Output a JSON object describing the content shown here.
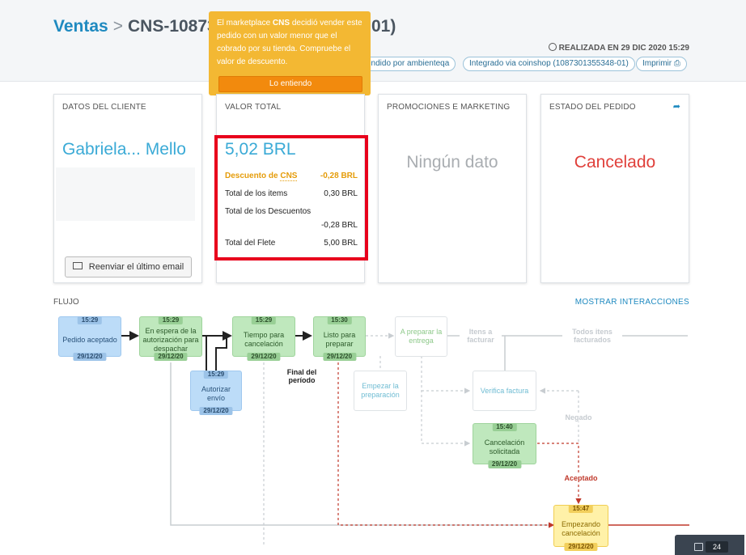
{
  "header": {
    "breadcrumb_root": "Ventas",
    "breadcrumb_sep": ">",
    "order_id": "CNS-10873",
    "order_id_tail": "01)",
    "realized": "REALIZADA EN 29 DIC 2020 15:29",
    "pills": {
      "sold_by": "endido por ambienteqa",
      "integrated": "Integrado via coinshop (1087301355348-01)",
      "print": "Imprimir"
    }
  },
  "tooltip": {
    "pre": "El marketplace ",
    "brand": "CNS",
    "post": " decidió vender este pedido con un valor menor que el cobrado por su tienda. Compruebe el valor de descuento.",
    "button": "Lo entiendo"
  },
  "cards": {
    "client": {
      "title": "DATOS DEL CLIENTE",
      "name": "Gabriela... Mello",
      "email_button": "Reenviar el último email"
    },
    "total": {
      "title": "VALOR TOTAL",
      "amount": "5,02 BRL",
      "discount_label": "Descuento de",
      "discount_brand": "CNS",
      "discount_value": "-0,28 BRL",
      "items_label": "Total de los items",
      "items_value": "0,30 BRL",
      "discounts_label": "Total de los Descuentos",
      "discounts_value": "-0,28 BRL",
      "freight_label": "Total del Flete",
      "freight_value": "5,00 BRL"
    },
    "promotions": {
      "title": "PROMOCIONES E MARKETING",
      "empty": "Ningún dato"
    },
    "status": {
      "title": "ESTADO DEL PEDIDO",
      "value": "Cancelado"
    }
  },
  "flow": {
    "title": "FLUJO",
    "show_interactions": "MOSTRAR INTERACCIONES",
    "nodes": {
      "n1": {
        "time": "15:29",
        "label": "Pedido aceptado",
        "date": "29/12/20"
      },
      "n2": {
        "time": "15:29",
        "label": "En espera de la autorización para despachar",
        "date": "29/12/20"
      },
      "n3": {
        "time": "15:29",
        "label": "Autorizar envío",
        "date": "29/12/20"
      },
      "n4": {
        "time": "15:29",
        "label": "Tiempo para cancelación",
        "date": "29/12/20"
      },
      "n5": {
        "time": "15:30",
        "label": "Listo para preparar",
        "date": "29/12/20"
      },
      "n6": {
        "label": "A preparar la entrega"
      },
      "n7": {
        "label": "Empezar la preparación"
      },
      "n8": {
        "label": "Verifica factura"
      },
      "n9": {
        "time": "15:40",
        "label": "Cancelación solicitada",
        "date": "29/12/20"
      },
      "n10": {
        "time": "15:47",
        "label": "Empezando cancelación",
        "date": "29/12/20"
      }
    },
    "labels": {
      "end_period": "Final del período",
      "items_to_invoice": "Itens a facturar",
      "all_invoiced": "Todos itens facturados",
      "denied": "Negado",
      "accepted": "Aceptado"
    }
  },
  "notifications": {
    "count": "24"
  }
}
